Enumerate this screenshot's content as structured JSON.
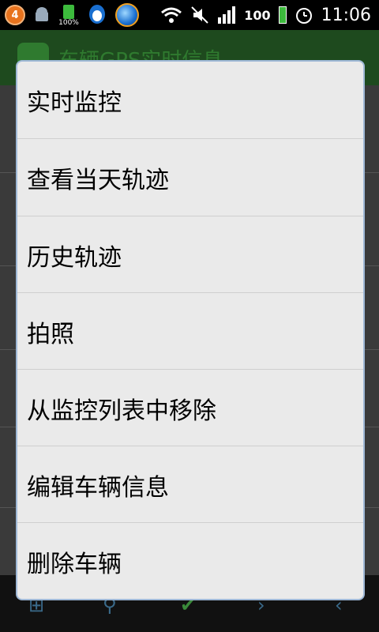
{
  "status_bar": {
    "notification_count": "4",
    "battery_small_label": "100%",
    "battery_label": "100",
    "time": "11:06"
  },
  "app": {
    "title": "车辆GPS实时信息"
  },
  "context_menu": {
    "items": [
      {
        "label": "实时监控"
      },
      {
        "label": "查看当天轨迹"
      },
      {
        "label": "历史轨迹"
      },
      {
        "label": "拍照"
      },
      {
        "label": "从监控列表中移除"
      },
      {
        "label": "编辑车辆信息"
      },
      {
        "label": "删除车辆"
      }
    ]
  },
  "colors": {
    "dialog_bg": "#eaeaea",
    "status_bar_bg": "#000000",
    "app_accent": "#2f7a2f"
  }
}
